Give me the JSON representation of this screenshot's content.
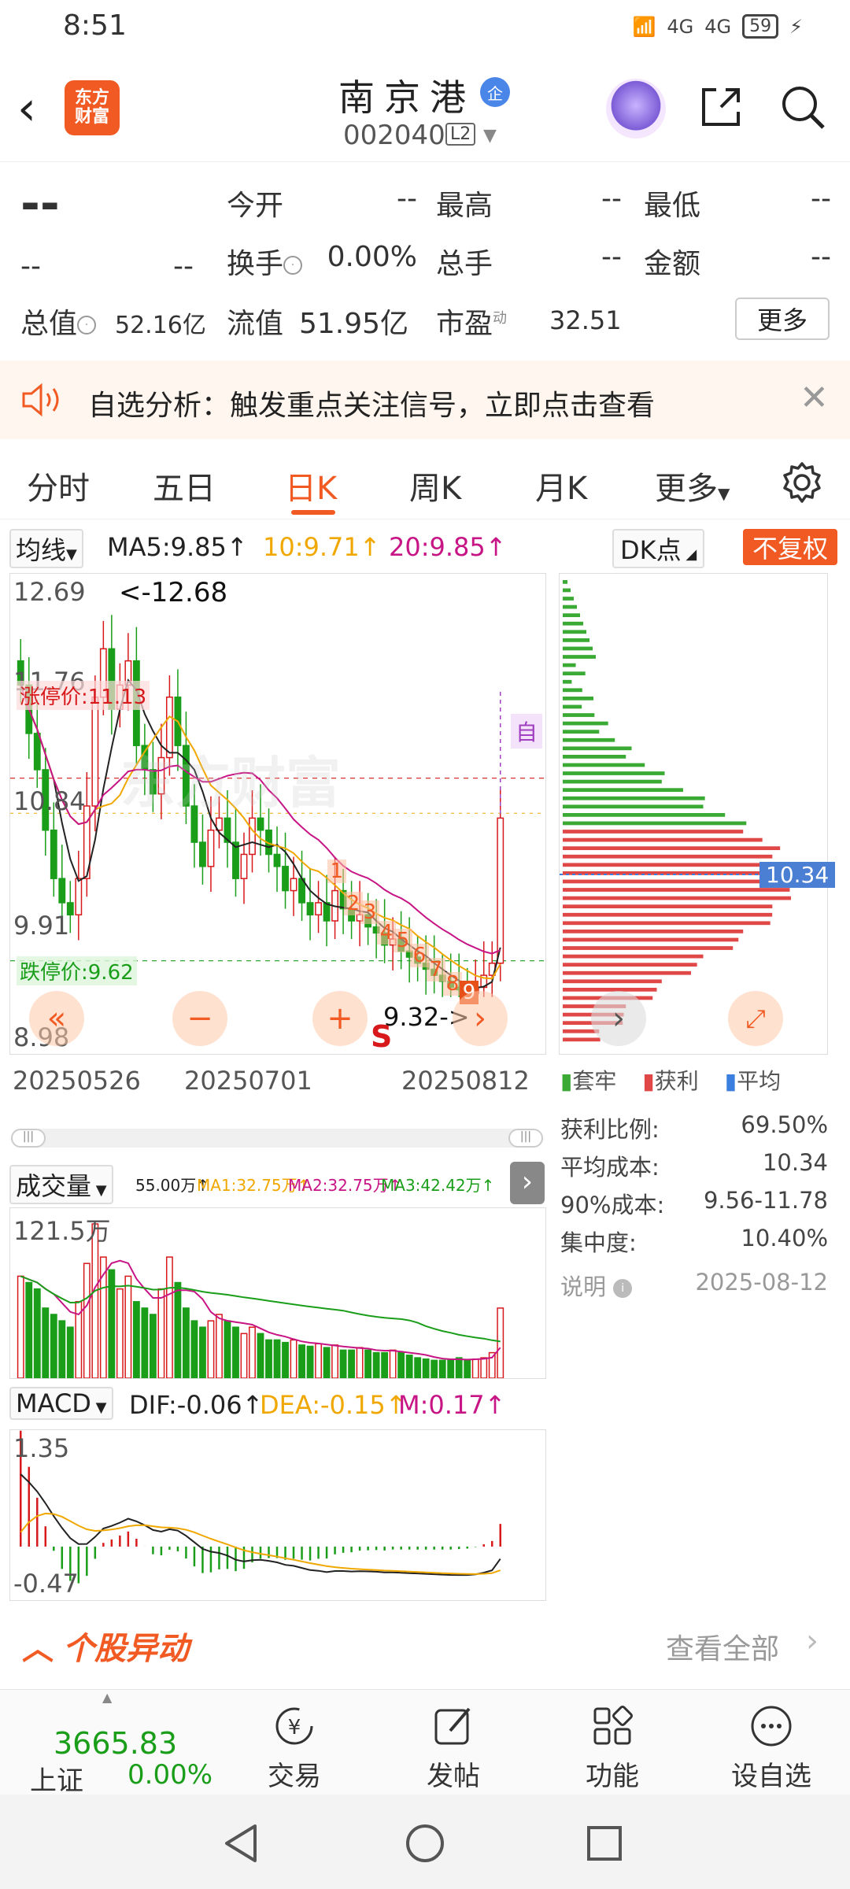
{
  "status_bar": {
    "time": "8:51",
    "network1": "4G",
    "network2": "4G",
    "battery": "59"
  },
  "header": {
    "logo_line1": "东方",
    "logo_line2": "财富",
    "title": "南京港",
    "title_badge": "企",
    "code": "002040",
    "level": "L2"
  },
  "quote": {
    "price": "--",
    "change": "--",
    "change_pct": "--",
    "open_label": "今开",
    "open": "--",
    "high_label": "最高",
    "high": "--",
    "low_label": "最低",
    "low": "--",
    "turnover_label": "换手",
    "turnover": "0.00%",
    "volume_label": "总手",
    "volume": "--",
    "amount_label": "金额",
    "amount": "--",
    "mktcap_label": "总值",
    "mktcap": "52.16亿",
    "float_label": "流值",
    "float": "51.95亿",
    "pe_label": "市盈",
    "pe_sup": "动",
    "pe": "32.51",
    "more_label": "更多"
  },
  "banner": {
    "text": "自选分析：触发重点关注信号，立即点击查看"
  },
  "tabs": {
    "items": [
      "分时",
      "五日",
      "日K",
      "周K",
      "月K",
      "更多"
    ],
    "active": "日K"
  },
  "ma_legend": {
    "selector": "均线",
    "ma5": "MA5:9.85↑",
    "ma10": "10:9.71↑",
    "ma20": "20:9.85↑",
    "dk_label": "DK点",
    "fq_label": "不复权",
    "colors": {
      "ma5": "#222222",
      "ma10": "#f0a800",
      "ma20": "#c71585"
    }
  },
  "kchart": {
    "y_labels": [
      "12.69",
      "11.76",
      "10.84",
      "9.91",
      "8.98"
    ],
    "high_mark": "<-12.68",
    "low_mark": "9.32->",
    "limit_up": "涨停价:11.13",
    "limit_down": "跌停价:9.62",
    "self_tag": "自",
    "sell_tag": "S",
    "count_marks": [
      "1",
      "2",
      "3",
      "4",
      "5",
      "6",
      "7",
      "8",
      "9"
    ],
    "x_labels": [
      "20250526",
      "20250701",
      "20250812"
    ],
    "watermark": "东方财富"
  },
  "chip": {
    "avg_price_tag": "10.34",
    "legend": [
      "套牢",
      "获利",
      "平均"
    ],
    "stats": [
      {
        "label": "获利比例:",
        "value": "69.50%"
      },
      {
        "label": "平均成本:",
        "value": "10.34"
      },
      {
        "label": "90%成本:",
        "value": "9.56-11.78"
      },
      {
        "label": "集中度:",
        "value": "10.40%"
      }
    ],
    "note_label": "说明",
    "date": "2025-08-12"
  },
  "volume": {
    "selector": "成交量",
    "v": "55.00万↑",
    "ma1": "MA1:32.75万↑",
    "ma2": "MA2:32.75万↑",
    "ma3": "MA3:42.42万↑",
    "ymax": "121.5万"
  },
  "macd": {
    "selector": "MACD",
    "dif": "DIF:-0.06↑",
    "dea": "DEA:-0.15↑",
    "m": "M:0.17↑",
    "ytop": "1.35",
    "ybottom": "-0.47"
  },
  "yidong": {
    "title": "个股异动",
    "view_all": "查看全部"
  },
  "tabbar": {
    "index_value": "3665.83",
    "index_name": "上证",
    "index_change": "0.00%",
    "items": [
      "交易",
      "发帖",
      "功能",
      "设自选"
    ]
  },
  "chart_data": [
    {
      "type": "candlestick",
      "title": "",
      "y_ticks": [
        12.69,
        11.76,
        10.84,
        9.91,
        8.98
      ],
      "x_ticks": [
        "20250526",
        "20250701",
        "20250812"
      ],
      "max_mark": 12.68,
      "min_mark": 9.32,
      "limit_up": 11.13,
      "limit_down": 9.62,
      "closes": [
        11.9,
        11.5,
        11.2,
        10.7,
        10.3,
        10.1,
        10.0,
        10.3,
        10.9,
        11.8,
        12.2,
        11.7,
        11.9,
        12.1,
        11.4,
        11.2,
        11.0,
        11.3,
        11.8,
        11.4,
        10.9,
        10.6,
        10.4,
        10.7,
        10.8,
        10.6,
        10.3,
        10.5,
        10.8,
        10.7,
        10.5,
        10.4,
        10.2,
        10.3,
        10.1,
        10.0,
        10.1,
        9.95,
        10.2,
        10.05,
        9.95,
        10.0,
        9.9,
        9.85,
        9.75,
        9.8,
        9.7,
        9.65,
        9.6,
        9.55,
        9.5,
        9.45,
        9.4,
        9.38,
        9.35,
        9.4,
        9.5,
        9.6,
        10.8
      ],
      "ma5_last": 9.85,
      "ma10_last": 9.71,
      "ma20_last": 9.85
    },
    {
      "type": "bar",
      "title": "成交量",
      "ymax_label": "121.5万",
      "values": [
        80,
        75,
        70,
        55,
        50,
        45,
        40,
        60,
        90,
        121,
        95,
        85,
        70,
        80,
        60,
        55,
        50,
        70,
        95,
        75,
        55,
        45,
        40,
        45,
        50,
        45,
        40,
        35,
        40,
        35,
        30,
        30,
        28,
        30,
        26,
        25,
        27,
        24,
        26,
        22,
        22,
        24,
        22,
        20,
        20,
        22,
        20,
        18,
        16,
        15,
        14,
        14,
        15,
        16,
        14,
        15,
        16,
        20,
        55
      ]
    },
    {
      "type": "line",
      "title": "MACD",
      "y_ticks": [
        1.35,
        -0.47
      ],
      "dif_last": -0.06,
      "dea_last": -0.15,
      "m_last": 0.17
    }
  ]
}
